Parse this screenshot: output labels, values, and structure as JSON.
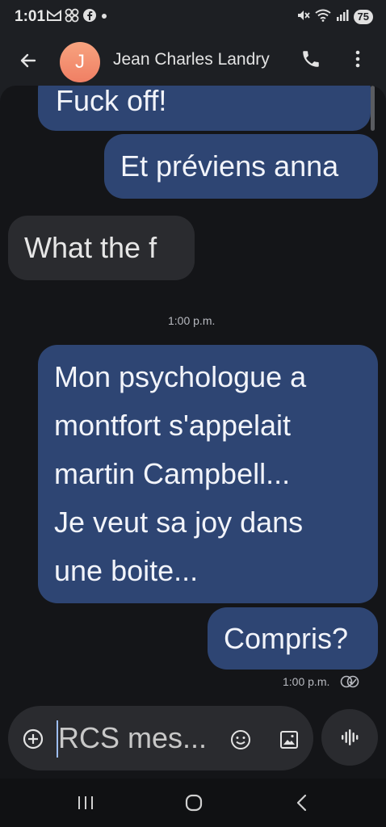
{
  "status_bar": {
    "time": "1:01",
    "battery": "75",
    "left_icons": [
      "gmail-icon",
      "pinwheel-icon",
      "facebook-icon",
      "dot-icon"
    ],
    "right_icons": [
      "mute-icon",
      "wifi-icon",
      "signal-icon"
    ]
  },
  "header": {
    "avatar_initial": "J",
    "contact_name": "Jean Charles Landry",
    "avatar_color": "#f28b6c"
  },
  "messages": [
    {
      "direction": "outgoing",
      "text": "Fuck off!"
    },
    {
      "direction": "outgoing",
      "text": "Et préviens anna"
    },
    {
      "direction": "incoming",
      "text": "What the f"
    },
    {
      "type": "timestamp",
      "text": "1:00 p.m."
    },
    {
      "direction": "outgoing",
      "lines": [
        "Mon psychologue a",
        "montfort s'appelait",
        "martin Campbell...",
        "Je veut sa joy dans",
        "une boite..."
      ]
    },
    {
      "direction": "outgoing",
      "text": "Compris?"
    },
    {
      "type": "timestamp",
      "text": "1:00 p.m.",
      "status": "read"
    }
  ],
  "compose": {
    "placeholder": "RCS mes..."
  },
  "colors": {
    "outgoing_bubble": "#2e4573",
    "incoming_bubble": "#2a2b2f",
    "background": "#141518",
    "header_background": "#1d1f23"
  }
}
